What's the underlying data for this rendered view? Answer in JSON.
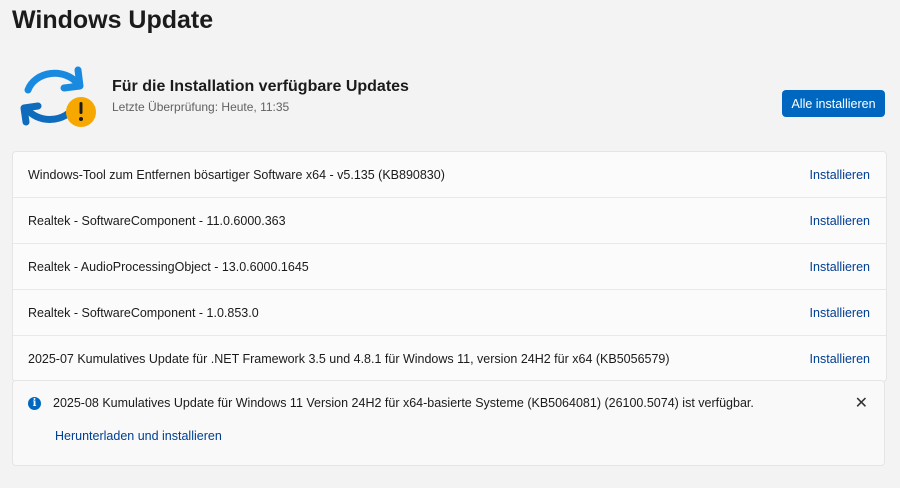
{
  "page_title": "Windows Update",
  "header": {
    "title": "Für die Installation verfügbare Updates",
    "subtitle": "Letzte Überprüfung: Heute, 11:35",
    "install_all_label": "Alle installieren",
    "icon": "sync-warning-icon"
  },
  "updates": [
    {
      "name": "Windows-Tool zum Entfernen bösartiger Software x64 - v5.135 (KB890830)",
      "action": "Installieren"
    },
    {
      "name": "Realtek - SoftwareComponent - 11.0.6000.363",
      "action": "Installieren"
    },
    {
      "name": "Realtek - AudioProcessingObject - 13.0.6000.1645",
      "action": "Installieren"
    },
    {
      "name": "Realtek - SoftwareComponent - 1.0.853.0",
      "action": "Installieren"
    },
    {
      "name": "2025-07 Kumulatives Update für .NET Framework 3.5 und 4.8.1 für Windows 11, version 24H2 für x64 (KB5056579)",
      "action": "Installieren"
    }
  ],
  "info_bar": {
    "icon_glyph": "i",
    "message": "2025-08 Kumulatives Update für Windows 11 Version 24H2 für x64-basierte Systeme (KB5064081) (26100.5074) ist verfügbar.",
    "link": "Herunterladen und installieren",
    "close_glyph": "✕"
  },
  "colors": {
    "accent": "#0067c0",
    "warning": "#f7a800",
    "link": "#003e92"
  }
}
